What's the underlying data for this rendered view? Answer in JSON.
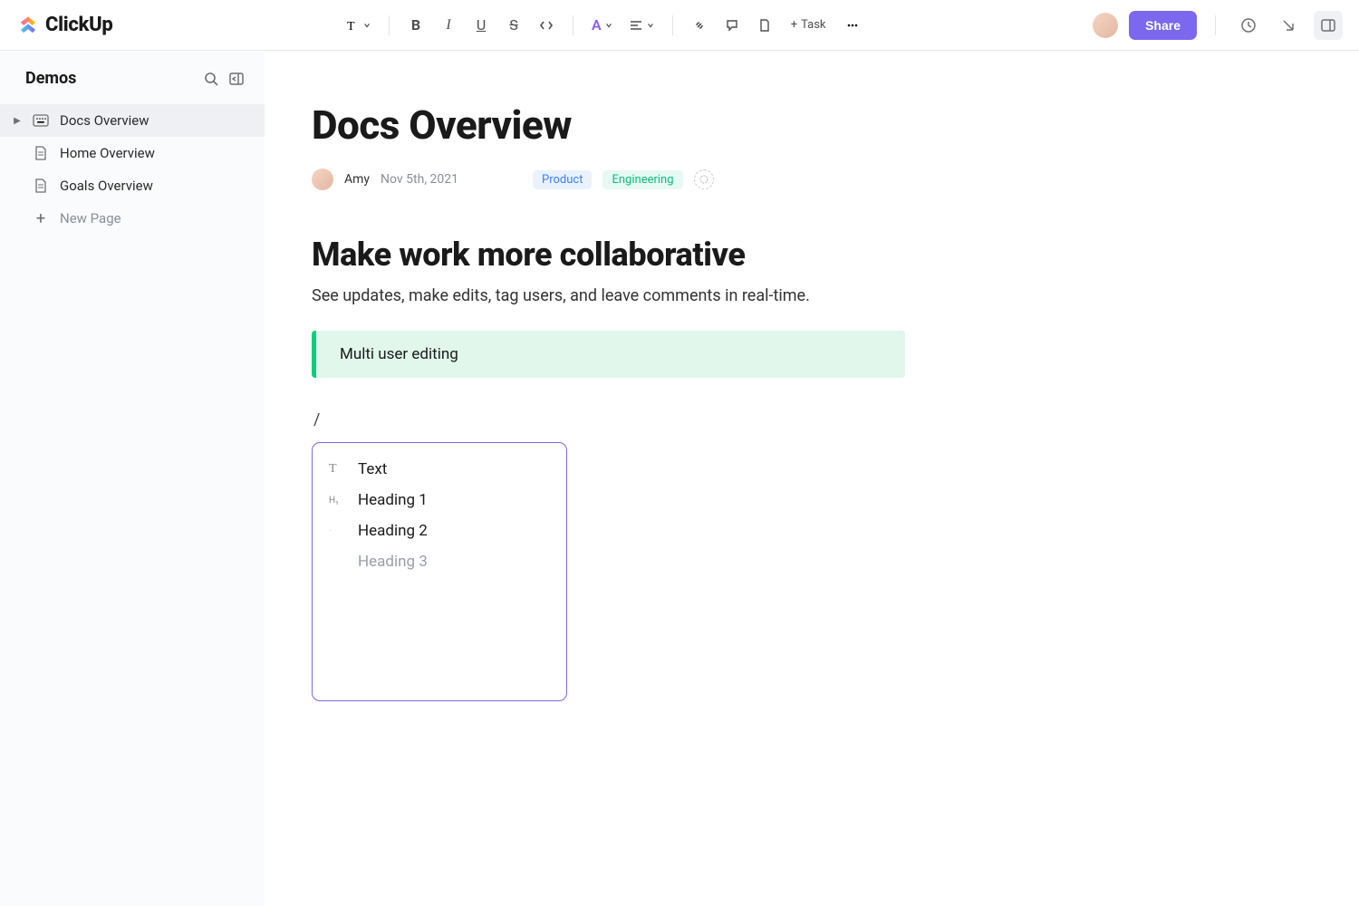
{
  "brand": "ClickUp",
  "toolbar": {
    "task_label": "Task",
    "share_label": "Share"
  },
  "sidebar": {
    "title": "Demos",
    "items": [
      {
        "label": "Docs Overview",
        "active": true,
        "expandable": true
      },
      {
        "label": "Home Overview",
        "active": false,
        "expandable": false
      },
      {
        "label": "Goals Overview",
        "active": false,
        "expandable": false
      }
    ],
    "new_page_label": "New Page"
  },
  "doc": {
    "title": "Docs Overview",
    "author": "Amy",
    "date": "Nov 5th, 2021",
    "tags": [
      {
        "label": "Product",
        "variant": "product"
      },
      {
        "label": "Engineering",
        "variant": "eng"
      }
    ],
    "heading": "Make work more collaborative",
    "paragraph": "See updates, make edits, tag users, and leave comments in real-time.",
    "callout": "Multi user editing",
    "slash_input": "/",
    "slash_menu": [
      {
        "label": "Text",
        "icon": "T",
        "dim": false
      },
      {
        "label": "Heading 1",
        "icon": "H1",
        "dim": false
      },
      {
        "label": "Heading 2",
        "icon": "H2",
        "dim": false
      },
      {
        "label": "Heading 3",
        "icon": "",
        "dim": true
      }
    ]
  }
}
